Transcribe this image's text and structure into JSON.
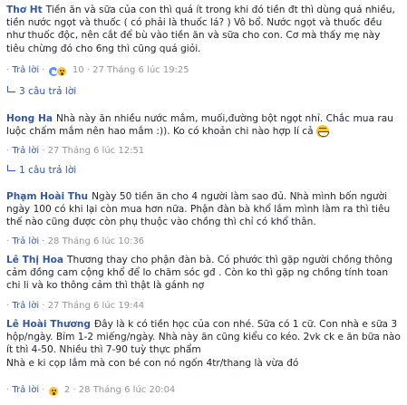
{
  "comments": [
    {
      "author": "Thơ Ht",
      "text": "Tiền ăn và sữa của con thì quá ít trong khi đó tiền đt thì dùng quá nhiều, tiền nước ngọt và thuốc ( có phải là thuốc lá? ) Vô bổ. Nước ngọt và thuốc đều như thuốc độc, nên cắt để bù vào tiền ăn và sữa cho con. Cơ mà thấy mẹ này tiêu chừng đó cho 6ng thì cũng quá giỏi.",
      "reply_label": "Trả lời",
      "reaction_count": "10",
      "timestamp": "27 Tháng 6 lúc 19:25"
    },
    {
      "author": "Hong Ha",
      "text": "Nhà này ăn nhiều nước mắm, muối,đường bột ngọt nhỉ. Chắc mua rau luộc chấm mắm nên hao mắm :)). Ko có khoản chi nào hợp lí cả",
      "reply_label": "Trả lời",
      "timestamp": "27 Tháng 6 lúc 12:51"
    },
    {
      "author": "Phạm Hoài Thu",
      "text": "Ngày 50 tiền ăn cho 4 người làm sao đủ. Nhà mình bốn người ngày 100 có khi lại còn mua hơn nữa. Phận đàn bà khổ lắm mình làm ra thì tiêu thế nào cũng được còn phụ thuộc vào chồng thì chỉ có khổ thân.",
      "reply_label": "Trả lời",
      "timestamp": "28 Tháng 6 lúc 10:36"
    },
    {
      "author": "Lê Thị Hoa",
      "text": "Thương thay cho phận đàn bà. Có phước thì gặp người chồng thông cảm đồng cam cộng khổ để lo chăm sóc gđ . Còn ko thì gặp ng chồng tính toan chi li và ko thông cảm thì thật là gánh nợ",
      "reply_label": "Trả lời",
      "timestamp": "27 Tháng 6 lúc 19:44"
    },
    {
      "author": "Lê Hoài Thương",
      "text": "Đây là k có tiền học của con nhé. Sữa có 1 cữ. Con nhà e sữa 3 hộp/ngày. Bỉm 1-2 miếng/ngày. Nhà này ăn cũng kiểu co kéo. 2vk ck e ăn bữa nào ít thì 4-50. Nhiều thì 7-90 tuỳ thực phẩm",
      "text2": "Nhà e ki cọp lắm mà con bé con nó ngốn 4tr/thang là vừa đó",
      "reply_label": "Trả lời",
      "reaction_count": "2",
      "timestamp": "28 Tháng 6 lúc 20:04"
    }
  ],
  "reply_links": [
    {
      "label": "3 câu trả lời"
    },
    {
      "label": "1 câu trả lời"
    }
  ],
  "separator": "·"
}
